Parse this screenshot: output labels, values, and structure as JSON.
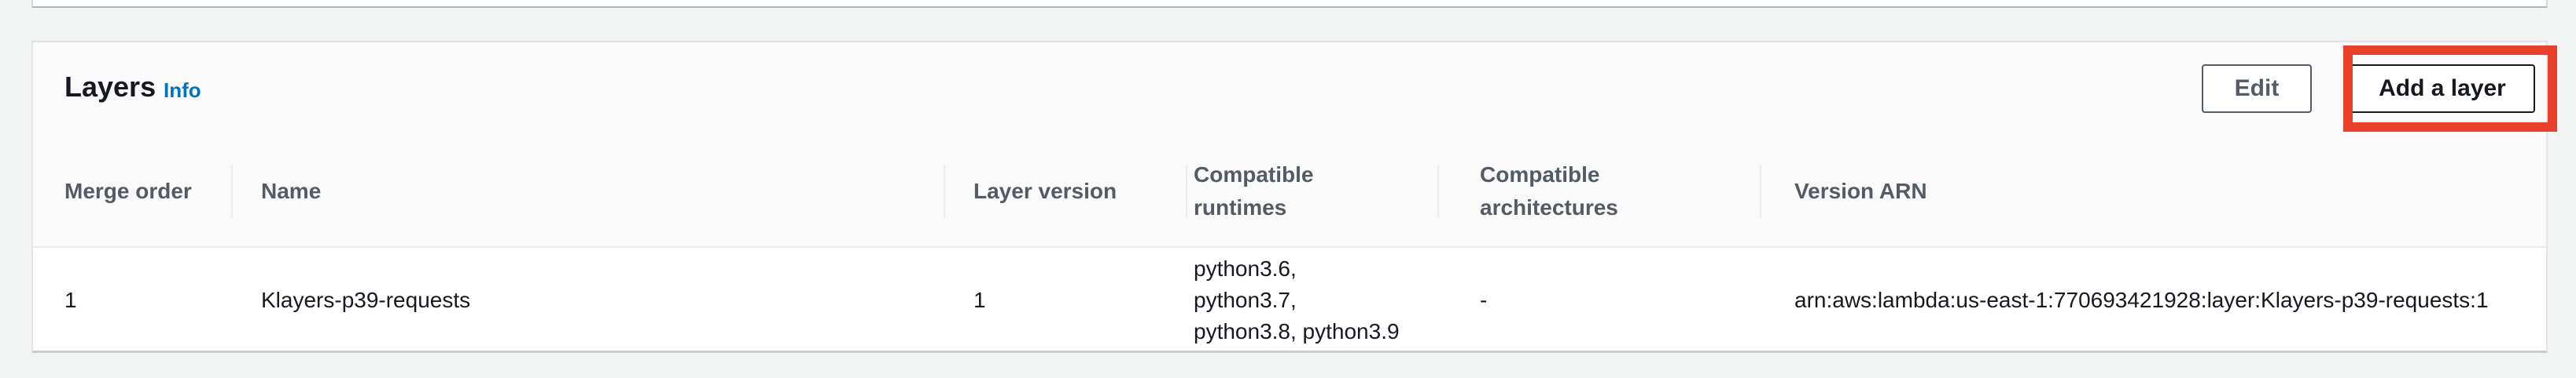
{
  "layers": {
    "title": "Layers",
    "info_label": "Info",
    "edit_label": "Edit",
    "add_label": "Add a layer",
    "columns": {
      "merge_order": "Merge order",
      "name": "Name",
      "layer_version": "Layer version",
      "compatible_runtimes": "Compatible\nruntimes",
      "compatible_architectures": "Compatible\narchitectures",
      "version_arn": "Version ARN"
    },
    "rows": [
      {
        "merge_order": "1",
        "name": "Klayers-p39-requests",
        "layer_version": "1",
        "compatible_runtimes": "python3.6,\npython3.7,\npython3.8, python3.9",
        "compatible_architectures": "-",
        "version_arn": "arn:aws:lambda:us-east-1:770693421928:layer:Klayers-p39-requests:1"
      }
    ]
  },
  "colors": {
    "link": "#0073bb",
    "highlight": "#e8402a",
    "header_bg": "#fafafa",
    "page_bg": "#f2f3f3"
  }
}
